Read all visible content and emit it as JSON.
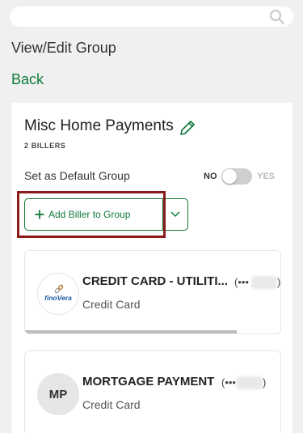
{
  "header": {
    "page_title": "View/Edit Group",
    "back_label": "Back"
  },
  "group": {
    "name": "Misc Home Payments",
    "billers_count": "2 BILLERS",
    "default_label": "Set as Default Group",
    "toggle_off_label": "NO",
    "toggle_on_label": "YES",
    "toggle_state": "off",
    "add_biller_label": "Add Biller to Group"
  },
  "billers": [
    {
      "name": "CREDIT CARD - UTILITI...",
      "masked_account": "(•••",
      "close_paren": ")",
      "type": "Credit Card",
      "logo_text": "finoVera"
    },
    {
      "name": "MORTGAGE PAYMENT",
      "masked_account": "(•••",
      "close_paren": ")",
      "type": "Credit Card",
      "initials": "MP"
    }
  ],
  "colors": {
    "accent": "#0e7a3a",
    "highlight": "#8b1a1a",
    "background": "#f0f0f0"
  },
  "icons": {
    "search": "search-icon",
    "edit": "pencil-icon",
    "add": "plus-icon",
    "dropdown": "chevron-down-icon",
    "logo_link": "link-icon"
  }
}
